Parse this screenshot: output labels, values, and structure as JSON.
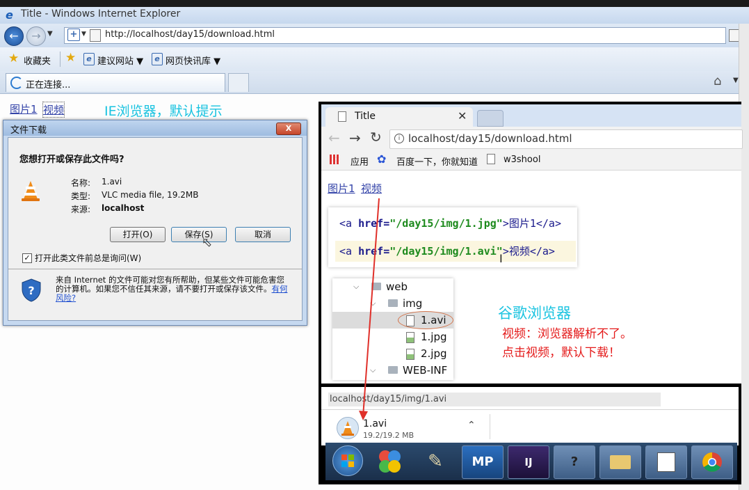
{
  "ie": {
    "title": "Title - Windows Internet Explorer",
    "url": "http://localhost/day15/download.html",
    "favorites_label": "收藏夹",
    "fav_items": [
      "建议网站 ▼",
      "网页快讯库 ▼"
    ],
    "tab_label": "正在连接...",
    "page_links": [
      "图片1",
      "视频"
    ]
  },
  "annotation_ie": "IE浏览器，默认提示",
  "dialog": {
    "title": "文件下载",
    "question": "您想打开或保存此文件吗?",
    "name_label": "名称:",
    "name_value": "1.avi",
    "type_label": "类型:",
    "type_value": "VLC media file, 19.2MB",
    "from_label": "来源:",
    "from_value": "localhost",
    "open_btn": "打开(O)",
    "save_btn": "保存(S)",
    "cancel_btn": "取消",
    "checkbox_label": "打开此类文件前总是询问(W)",
    "warning_text": "来自 Internet 的文件可能对您有所帮助，但某些文件可能危害您的计算机。如果您不信任其来源，请不要打开或保存该文件。",
    "risk_link": "有何风险?"
  },
  "chrome": {
    "tab_title": "Title",
    "url": "localhost/day15/download.html",
    "bookmarks": [
      "应用",
      "百度一下，你就知道",
      "w3shool"
    ],
    "page_links": [
      "图片1",
      "视频"
    ]
  },
  "code": {
    "line1": {
      "open": "<a ",
      "attr": "href=",
      "val": "\"/day15/img/1.jpg\"",
      "text": ">图片1</a>"
    },
    "line2": {
      "open": "<a ",
      "attr": "href=",
      "val": "\"/day15/img/1.avi\"",
      "text": ">视频</a>"
    }
  },
  "tree": [
    {
      "label": "web"
    },
    {
      "label": "img"
    },
    {
      "label": "1.avi"
    },
    {
      "label": "1.jpg"
    },
    {
      "label": "2.jpg"
    },
    {
      "label": "WEB-INF"
    }
  ],
  "annotation_chrome": {
    "title": "谷歌浏览器",
    "line1": "视频：浏览器解析不了。",
    "line2": "点击视频，默认下载！"
  },
  "download": {
    "status_url": "localhost/day15/img/1.avi",
    "file": "1.avi",
    "size": "19.2/19.2 MB"
  },
  "taskbar": {
    "mp_label": "MP",
    "ij_label": "IJ"
  },
  "colors": {
    "annotation_cyan": "#19c3e0",
    "annotation_red": "#e41a1a",
    "arrow_red": "#e0302a"
  }
}
